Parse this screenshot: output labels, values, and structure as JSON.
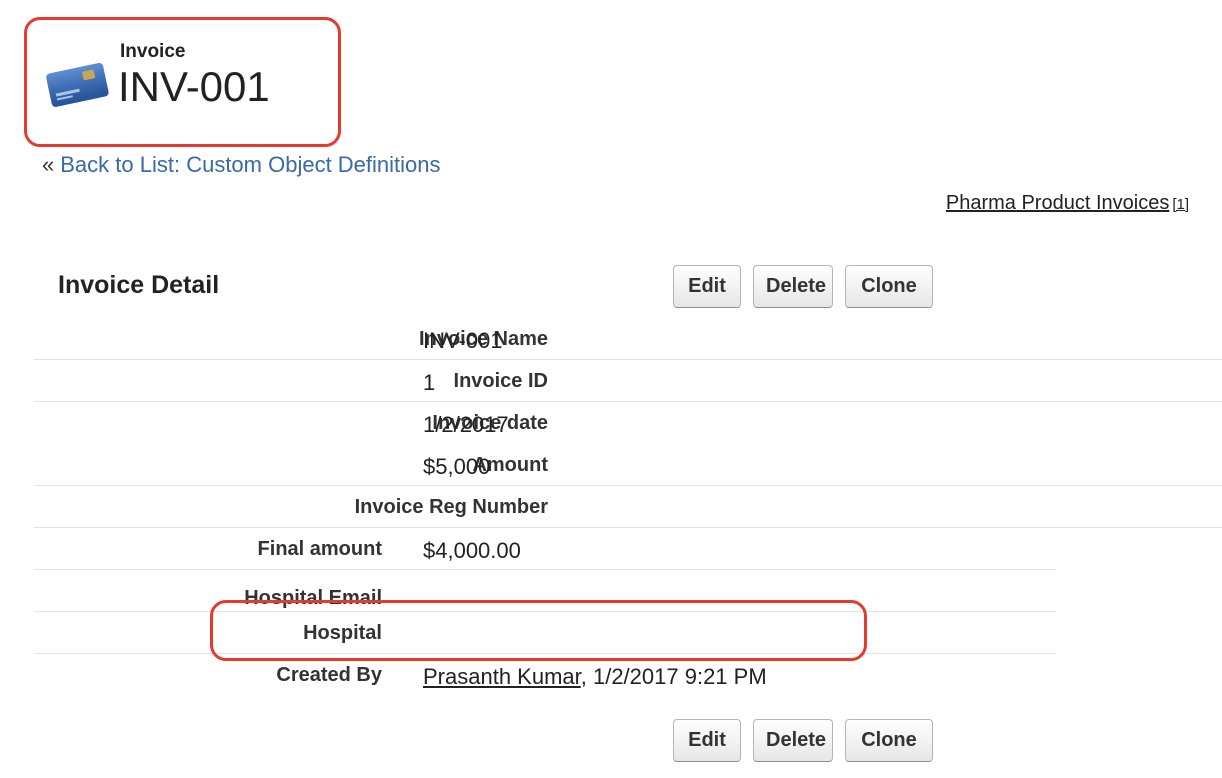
{
  "header": {
    "object_type": "Invoice",
    "record_name": "INV-001",
    "icon": "credit-card-icon"
  },
  "back_link": {
    "prefix": "«",
    "label": "Back to List: Custom Object Definitions"
  },
  "related_list_link": {
    "label": "Pharma Product Invoices",
    "count": "[1]"
  },
  "detail": {
    "title": "Invoice Detail",
    "buttons": {
      "edit": "Edit",
      "delete": "Delete",
      "clone": "Clone"
    },
    "fields": [
      {
        "label": "Invoice Name",
        "value": "INV-001"
      },
      {
        "label": "Invoice ID",
        "value": "1"
      },
      {
        "label": "Invoice date",
        "value": "1/2/2017"
      },
      {
        "label": "Amount",
        "value": "$5,000"
      },
      {
        "label": "Invoice Reg Number",
        "value": ""
      },
      {
        "label": "Final amount",
        "value": "$4,000.00"
      },
      {
        "label": "Hospital Email",
        "value": ""
      },
      {
        "label": "Hospital",
        "value": ""
      },
      {
        "label": "Created By",
        "user": "Prasanth Kumar",
        "timestamp": ", 1/2/2017 9:21 PM"
      }
    ]
  },
  "colors": {
    "highlight": "#e53a2f",
    "link": "#3869a8"
  }
}
